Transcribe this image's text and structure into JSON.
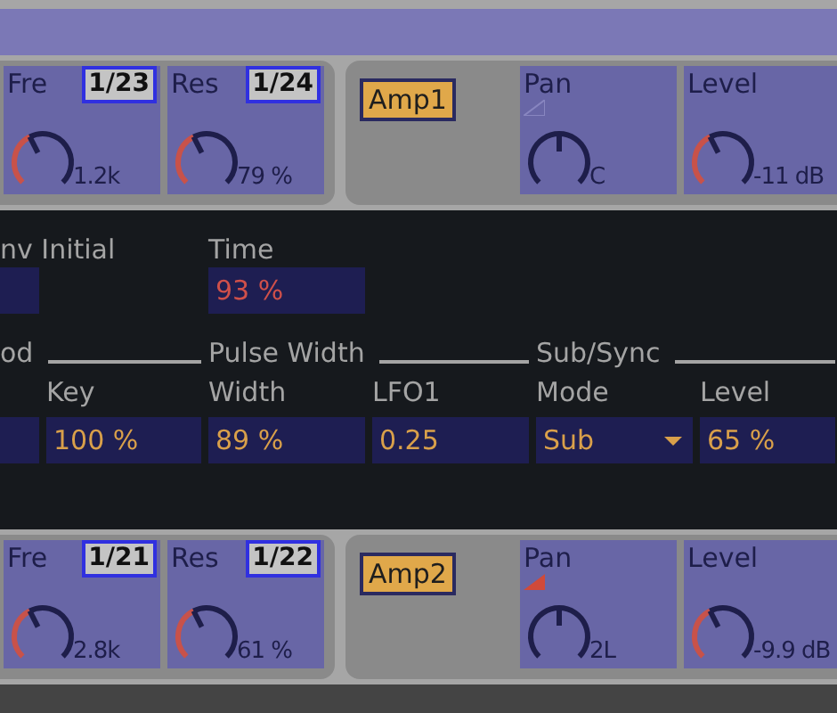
{
  "upper_strip": {
    "filter_knobs": [
      {
        "label": "Fre",
        "badge": "1/23",
        "value": "1.2k"
      },
      {
        "label": "Res",
        "badge": "1/24",
        "value": "79 %"
      }
    ],
    "amp": {
      "button": "Amp1",
      "on": true,
      "pan": {
        "label": "Pan",
        "value": "C",
        "modulated": false
      },
      "volume": {
        "label": "Level",
        "value": "-11 dB"
      }
    }
  },
  "oscillator_panel": {
    "envelope_label": "nv Initial",
    "time": {
      "label": "Time",
      "value": "93 %",
      "modulated": true
    },
    "groups": [
      {
        "title": "od",
        "controls": [
          {
            "label": "Key",
            "value": "100 %",
            "kind": "field"
          }
        ]
      },
      {
        "title": "Pulse Width",
        "controls": [
          {
            "label": "Width",
            "value": "89 %",
            "kind": "field"
          },
          {
            "label": "LFO1",
            "value": "0.25",
            "kind": "field"
          }
        ]
      },
      {
        "title": "Sub/Sync",
        "controls": [
          {
            "label": "Mode",
            "value": "Sub",
            "kind": "dropdown"
          },
          {
            "label": "Level",
            "value": "65 %",
            "kind": "field"
          }
        ]
      }
    ]
  },
  "lower_strip": {
    "filter_knobs": [
      {
        "label": "Fre",
        "badge": "1/21",
        "value": "2.8k"
      },
      {
        "label": "Res",
        "badge": "1/22",
        "value": "61 %"
      }
    ],
    "amp": {
      "button": "Amp2",
      "on": true,
      "pan": {
        "label": "Pan",
        "value": "2L",
        "modulated": true
      },
      "volume": {
        "label": "Level",
        "value": "-9.9 dB"
      }
    }
  }
}
